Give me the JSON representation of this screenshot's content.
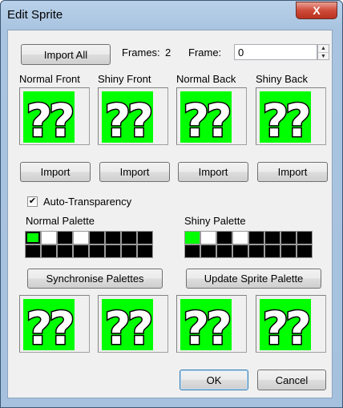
{
  "window": {
    "title": "Edit Sprite",
    "close_glyph": "X"
  },
  "toolbar": {
    "import_all_label": "Import All",
    "frames_label": "Frames:",
    "frames_value": "2",
    "frame_label": "Frame:",
    "frame_value": "0"
  },
  "sprites": [
    {
      "label": "Normal Front",
      "import_label": "Import"
    },
    {
      "label": "Shiny Front",
      "import_label": "Import"
    },
    {
      "label": "Normal Back",
      "import_label": "Import"
    },
    {
      "label": "Shiny Back",
      "import_label": "Import"
    }
  ],
  "auto_transparency": {
    "label": "Auto-Transparency",
    "checked": true,
    "check_glyph": "✔"
  },
  "palettes": {
    "normal_label": "Normal Palette",
    "shiny_label": "Shiny Palette",
    "normal_colors": [
      "#00ff00",
      "#ffffff",
      "#000000",
      "#ffffff",
      "#000000",
      "#000000",
      "#000000",
      "#000000",
      "#000000",
      "#000000",
      "#000000",
      "#000000",
      "#000000",
      "#000000",
      "#000000",
      "#000000"
    ],
    "shiny_colors": [
      "#00ff00",
      "#ffffff",
      "#000000",
      "#ffffff",
      "#000000",
      "#000000",
      "#000000",
      "#000000",
      "#000000",
      "#000000",
      "#000000",
      "#000000",
      "#000000",
      "#000000",
      "#000000",
      "#000000"
    ],
    "normal_selected_index": 0
  },
  "actions": {
    "synchronise_label": "Synchronise Palettes",
    "update_label": "Update Sprite Palette",
    "ok_label": "OK",
    "cancel_label": "Cancel"
  },
  "sprite_colors": {
    "background": "#00ff00",
    "glyph_fill": "#ffffff",
    "glyph_outline": "#000000"
  },
  "sprite_glyph": "??"
}
